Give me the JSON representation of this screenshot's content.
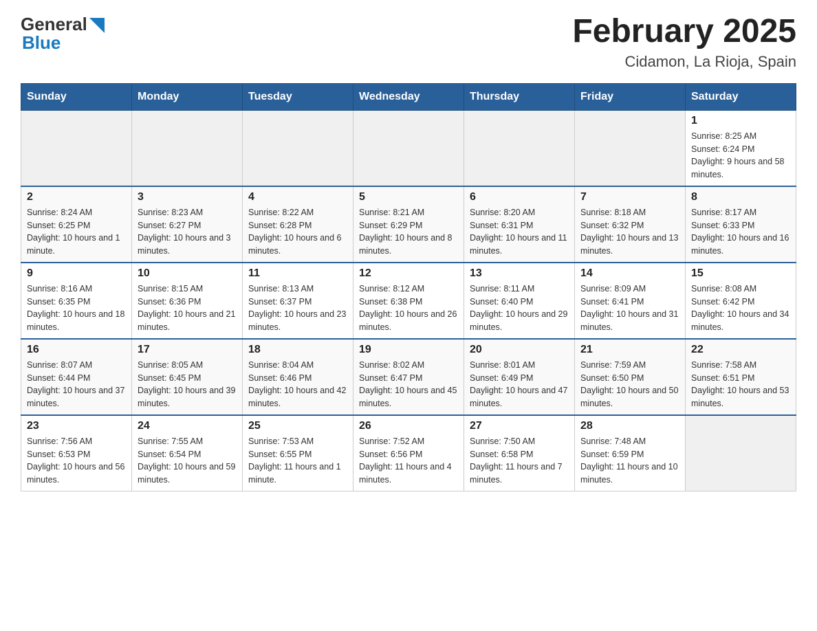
{
  "header": {
    "logo": {
      "general": "General",
      "blue": "Blue",
      "triangle": "▶"
    },
    "title": "February 2025",
    "subtitle": "Cidamon, La Rioja, Spain"
  },
  "weekdays": [
    "Sunday",
    "Monday",
    "Tuesday",
    "Wednesday",
    "Thursday",
    "Friday",
    "Saturday"
  ],
  "weeks": [
    [
      {
        "day": "",
        "info": ""
      },
      {
        "day": "",
        "info": ""
      },
      {
        "day": "",
        "info": ""
      },
      {
        "day": "",
        "info": ""
      },
      {
        "day": "",
        "info": ""
      },
      {
        "day": "",
        "info": ""
      },
      {
        "day": "1",
        "info": "Sunrise: 8:25 AM\nSunset: 6:24 PM\nDaylight: 9 hours and 58 minutes."
      }
    ],
    [
      {
        "day": "2",
        "info": "Sunrise: 8:24 AM\nSunset: 6:25 PM\nDaylight: 10 hours and 1 minute."
      },
      {
        "day": "3",
        "info": "Sunrise: 8:23 AM\nSunset: 6:27 PM\nDaylight: 10 hours and 3 minutes."
      },
      {
        "day": "4",
        "info": "Sunrise: 8:22 AM\nSunset: 6:28 PM\nDaylight: 10 hours and 6 minutes."
      },
      {
        "day": "5",
        "info": "Sunrise: 8:21 AM\nSunset: 6:29 PM\nDaylight: 10 hours and 8 minutes."
      },
      {
        "day": "6",
        "info": "Sunrise: 8:20 AM\nSunset: 6:31 PM\nDaylight: 10 hours and 11 minutes."
      },
      {
        "day": "7",
        "info": "Sunrise: 8:18 AM\nSunset: 6:32 PM\nDaylight: 10 hours and 13 minutes."
      },
      {
        "day": "8",
        "info": "Sunrise: 8:17 AM\nSunset: 6:33 PM\nDaylight: 10 hours and 16 minutes."
      }
    ],
    [
      {
        "day": "9",
        "info": "Sunrise: 8:16 AM\nSunset: 6:35 PM\nDaylight: 10 hours and 18 minutes."
      },
      {
        "day": "10",
        "info": "Sunrise: 8:15 AM\nSunset: 6:36 PM\nDaylight: 10 hours and 21 minutes."
      },
      {
        "day": "11",
        "info": "Sunrise: 8:13 AM\nSunset: 6:37 PM\nDaylight: 10 hours and 23 minutes."
      },
      {
        "day": "12",
        "info": "Sunrise: 8:12 AM\nSunset: 6:38 PM\nDaylight: 10 hours and 26 minutes."
      },
      {
        "day": "13",
        "info": "Sunrise: 8:11 AM\nSunset: 6:40 PM\nDaylight: 10 hours and 29 minutes."
      },
      {
        "day": "14",
        "info": "Sunrise: 8:09 AM\nSunset: 6:41 PM\nDaylight: 10 hours and 31 minutes."
      },
      {
        "day": "15",
        "info": "Sunrise: 8:08 AM\nSunset: 6:42 PM\nDaylight: 10 hours and 34 minutes."
      }
    ],
    [
      {
        "day": "16",
        "info": "Sunrise: 8:07 AM\nSunset: 6:44 PM\nDaylight: 10 hours and 37 minutes."
      },
      {
        "day": "17",
        "info": "Sunrise: 8:05 AM\nSunset: 6:45 PM\nDaylight: 10 hours and 39 minutes."
      },
      {
        "day": "18",
        "info": "Sunrise: 8:04 AM\nSunset: 6:46 PM\nDaylight: 10 hours and 42 minutes."
      },
      {
        "day": "19",
        "info": "Sunrise: 8:02 AM\nSunset: 6:47 PM\nDaylight: 10 hours and 45 minutes."
      },
      {
        "day": "20",
        "info": "Sunrise: 8:01 AM\nSunset: 6:49 PM\nDaylight: 10 hours and 47 minutes."
      },
      {
        "day": "21",
        "info": "Sunrise: 7:59 AM\nSunset: 6:50 PM\nDaylight: 10 hours and 50 minutes."
      },
      {
        "day": "22",
        "info": "Sunrise: 7:58 AM\nSunset: 6:51 PM\nDaylight: 10 hours and 53 minutes."
      }
    ],
    [
      {
        "day": "23",
        "info": "Sunrise: 7:56 AM\nSunset: 6:53 PM\nDaylight: 10 hours and 56 minutes."
      },
      {
        "day": "24",
        "info": "Sunrise: 7:55 AM\nSunset: 6:54 PM\nDaylight: 10 hours and 59 minutes."
      },
      {
        "day": "25",
        "info": "Sunrise: 7:53 AM\nSunset: 6:55 PM\nDaylight: 11 hours and 1 minute."
      },
      {
        "day": "26",
        "info": "Sunrise: 7:52 AM\nSunset: 6:56 PM\nDaylight: 11 hours and 4 minutes."
      },
      {
        "day": "27",
        "info": "Sunrise: 7:50 AM\nSunset: 6:58 PM\nDaylight: 11 hours and 7 minutes."
      },
      {
        "day": "28",
        "info": "Sunrise: 7:48 AM\nSunset: 6:59 PM\nDaylight: 11 hours and 10 minutes."
      },
      {
        "day": "",
        "info": ""
      }
    ]
  ]
}
